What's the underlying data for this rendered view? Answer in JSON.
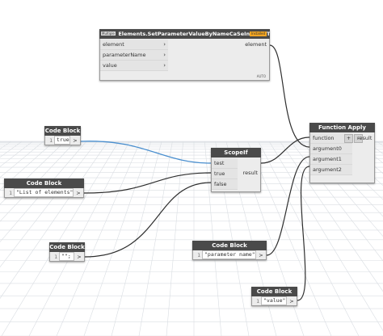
{
  "set_param_node": {
    "badge": "Multiple",
    "title": "Elements.SetParameterValueByNameCaSeInSeNsITiVe",
    "tag": "Installed",
    "inputs": [
      "element",
      "parameterName",
      "value"
    ],
    "output": "element",
    "lacing": "AUTO"
  },
  "function_apply_node": {
    "title": "Function Apply",
    "inputs": [
      "function",
      "argument0",
      "argument1",
      "argument2"
    ],
    "output": "result",
    "add_label": "+",
    "remove_label": "-"
  },
  "scopeif_node": {
    "title": "ScopeIf",
    "inputs": [
      "test",
      "true",
      "false"
    ],
    "output": "result"
  },
  "code_blocks": [
    {
      "title": "Code Block",
      "line": "1",
      "code": "true;",
      "port": ">"
    },
    {
      "title": "Code Block",
      "line": "1",
      "code": "\"List of elements\";",
      "port": ">"
    },
    {
      "title": "Code Block",
      "line": "1",
      "code": "\"\";",
      "port": ">"
    },
    {
      "title": "Code Block",
      "line": "1",
      "code": "\"parameter name\";",
      "port": ">"
    },
    {
      "title": "Code Block",
      "line": "1",
      "code": "\"value\";",
      "port": ">"
    }
  ],
  "colors": {
    "wire": "#2e2e2e",
    "wire_bool": "#4a8fcf",
    "node_header": "#4a4a4a",
    "node_body": "#ececec",
    "grid": "#d9dde2",
    "badge": "#f3a623"
  }
}
